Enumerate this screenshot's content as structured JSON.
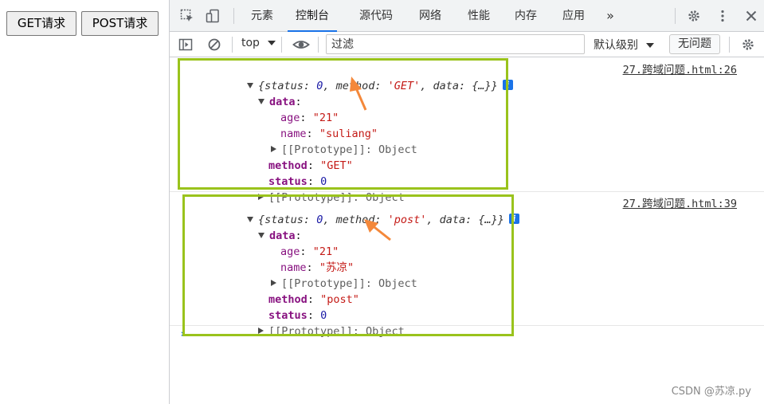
{
  "page": {
    "get_button": "GET请求",
    "post_button": "POST请求"
  },
  "devtools": {
    "tabs": [
      {
        "label": "元素"
      },
      {
        "label": "控制台",
        "active": true
      },
      {
        "label": "源代码"
      },
      {
        "label": "网络"
      },
      {
        "label": "性能"
      },
      {
        "label": "内存"
      },
      {
        "label": "应用"
      }
    ],
    "more_tabs": "»",
    "filterbar": {
      "context": "top",
      "filter_placeholder": "过滤",
      "levels": "默认级别",
      "issues": "无问题"
    }
  },
  "console": {
    "messages": [
      {
        "summary_prefix": "{status: ",
        "summary_status": "0",
        "summary_mid": ", method: ",
        "summary_method": "'GET'",
        "summary_suffix": ", data: {…}}",
        "source": "27.跨域问题.html:26",
        "data_key": "data",
        "age_key": "age",
        "age_value": "\"21\"",
        "name_key": "name",
        "name_value": "\"suliang\"",
        "proto_data": "[[Prototype]]: Object",
        "method_key": "method",
        "method_value": "\"GET\"",
        "status_key": "status",
        "status_value": "0",
        "proto_root": "[[Prototype]]: Object"
      },
      {
        "summary_prefix": "{status: ",
        "summary_status": "0",
        "summary_mid": ", method: ",
        "summary_method": "'post'",
        "summary_suffix": ", data: {…}}",
        "source": "27.跨域问题.html:39",
        "data_key": "data",
        "age_key": "age",
        "age_value": "\"21\"",
        "name_key": "name",
        "name_value": "\"苏凉\"",
        "proto_data": "[[Prototype]]: Object",
        "method_key": "method",
        "method_value": "\"post\"",
        "status_key": "status",
        "status_value": "0",
        "proto_root": "[[Prototype]]: Object"
      }
    ],
    "prompt": "›"
  },
  "watermark": "CSDN @苏凉.py",
  "colors": {
    "highlight": "#9ac31c",
    "arrow": "#f4883a",
    "active_tab": "#1a73e8"
  }
}
